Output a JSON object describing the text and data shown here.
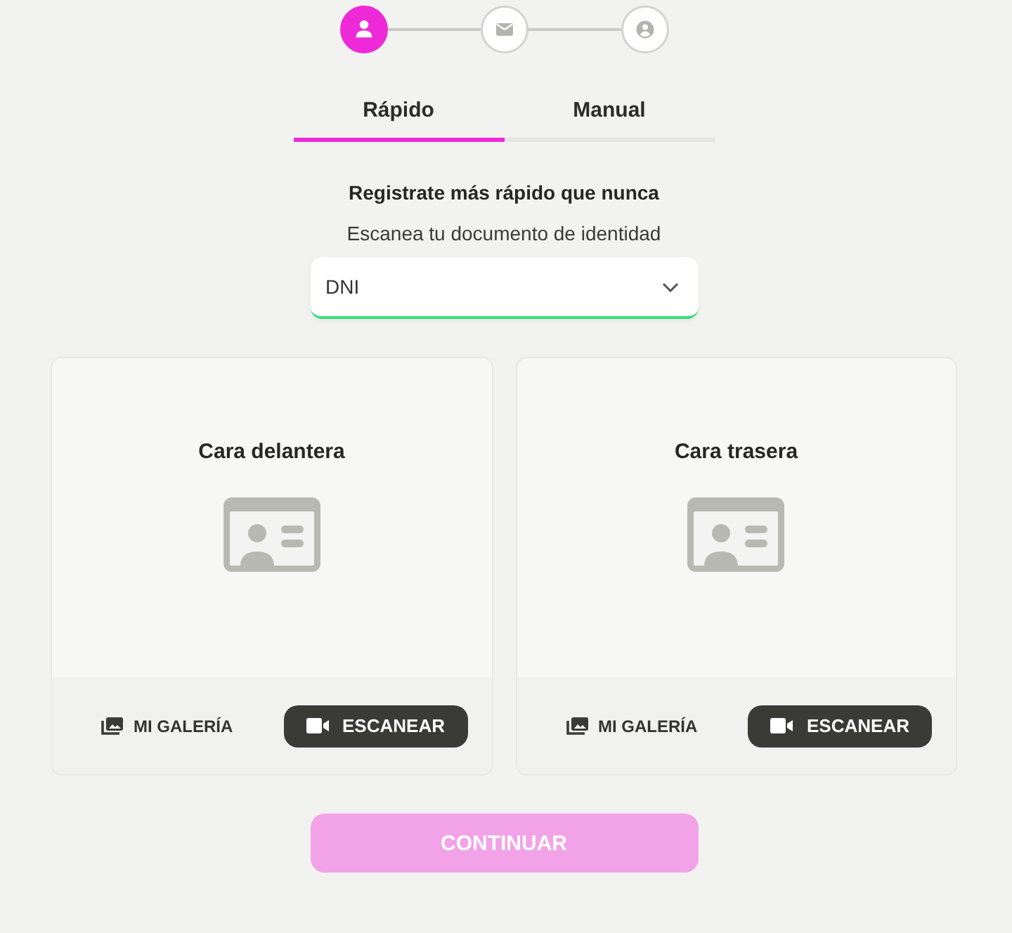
{
  "stepper": [
    {
      "kind": "person",
      "active": true
    },
    {
      "kind": "mail",
      "active": false
    },
    {
      "kind": "account",
      "active": false
    }
  ],
  "tabs": [
    {
      "label": "Rápido",
      "selected": true
    },
    {
      "label": "Manual",
      "selected": false
    }
  ],
  "heading": "Registrate más rápido que nunca",
  "subtitle": "Escanea tu documento de identidad",
  "document_select": {
    "value": "DNI",
    "focused": true
  },
  "cards": [
    {
      "title": "Cara delantera",
      "gallery_button": "MI GALERÍA",
      "scan_button": "ESCANEAR"
    },
    {
      "title": "Cara trasera",
      "gallery_button": "MI GALERÍA",
      "scan_button": "ESCANEAR"
    }
  ],
  "continue_button": {
    "label": "CONTINUAR",
    "disabled": true
  }
}
